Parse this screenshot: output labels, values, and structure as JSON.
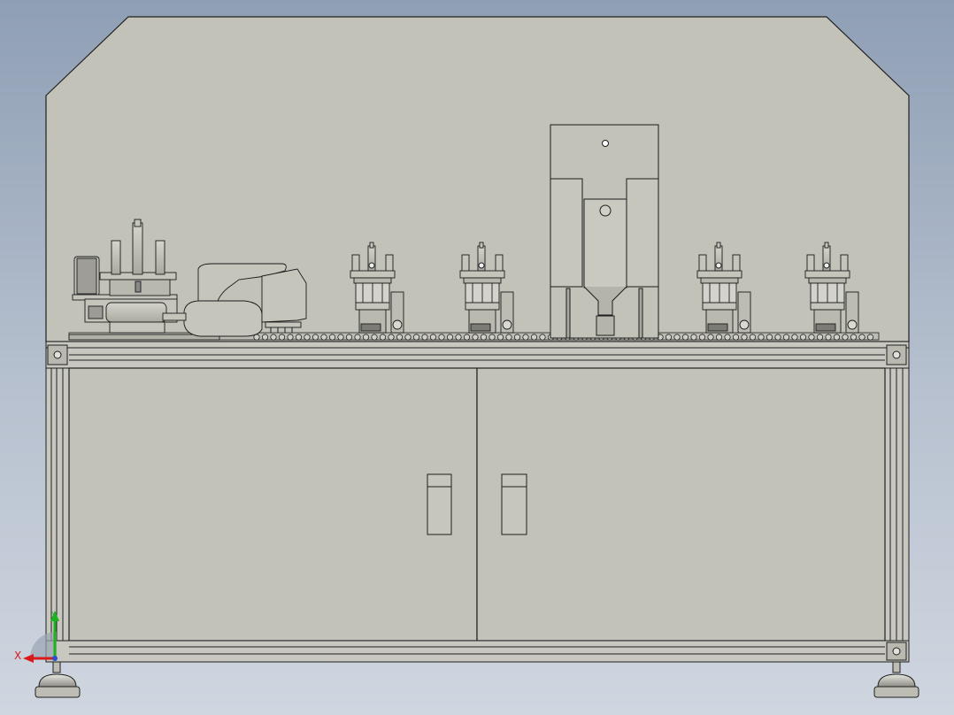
{
  "view": {
    "background_top": "#8f9fb5",
    "background_bottom": "#cfd6e0",
    "part_fill": "#c2c2b8",
    "edge_color": "#202020"
  },
  "triad": {
    "x_label": "X",
    "y_label": "Y",
    "x_color": "#d81a1a",
    "y_color": "#1fb21f",
    "z_color": "#2a4fd0"
  }
}
